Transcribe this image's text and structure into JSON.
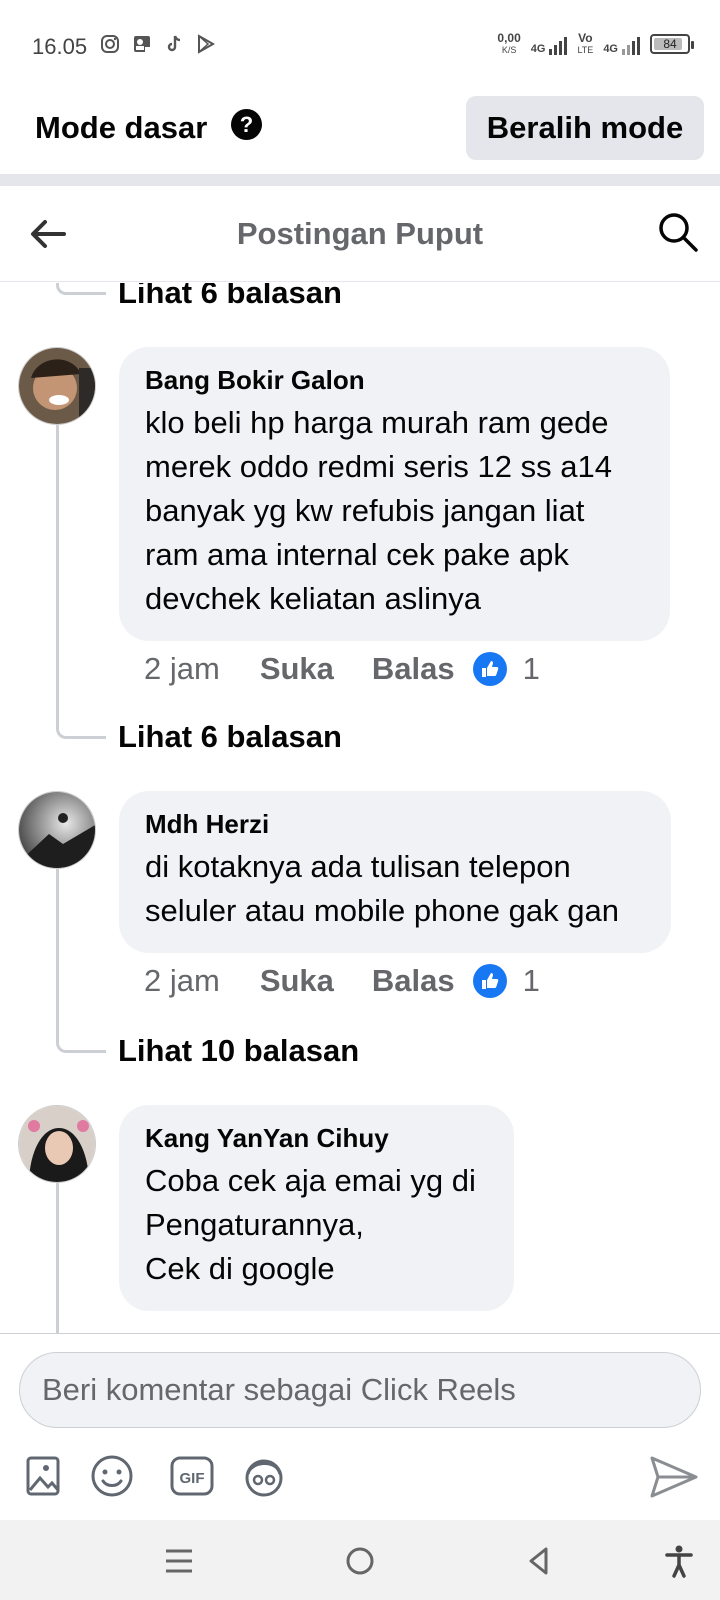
{
  "status_bar": {
    "time": "16.05",
    "speed_value": "0,00",
    "speed_unit": "K/S",
    "net1": "4G",
    "net2_top": "Vo",
    "net2_bottom": "LTE",
    "net3": "4G",
    "battery": "84"
  },
  "mode_bar": {
    "title": "Mode dasar",
    "help_glyph": "?",
    "switch_label": "Beralih mode"
  },
  "header": {
    "title": "Postingan Puput"
  },
  "comments": {
    "view_replies_top": "Lihat 6 balasan",
    "items": [
      {
        "author": "Bang Bokir Galon",
        "text": "klo beli hp harga murah ram gede\nmerek oddo redmi seris 12 ss a14\nbanyak yg kw refubis jangan liat\nram ama internal cek pake apk\ndevchek keliatan aslinya",
        "time": "2 jam",
        "like_label": "Suka",
        "reply_label": "Balas",
        "reaction_count": "1",
        "view_replies": "Lihat 6 balasan"
      },
      {
        "author": "Mdh Herzi",
        "text": "di kotaknya ada tulisan telepon\nseluler atau mobile phone gak gan",
        "time": "2 jam",
        "like_label": "Suka",
        "reply_label": "Balas",
        "reaction_count": "1",
        "view_replies": "Lihat 10 balasan"
      },
      {
        "author": "Kang YanYan Cihuy",
        "text": "Coba cek aja emai yg di\nPengaturannya,\nCek di google"
      }
    ]
  },
  "composer": {
    "placeholder": "Beri komentar sebagai Click Reels"
  },
  "colors": {
    "accent": "#1877f2",
    "bubble": "#f0f2f5",
    "secondary_text": "#65676b"
  }
}
